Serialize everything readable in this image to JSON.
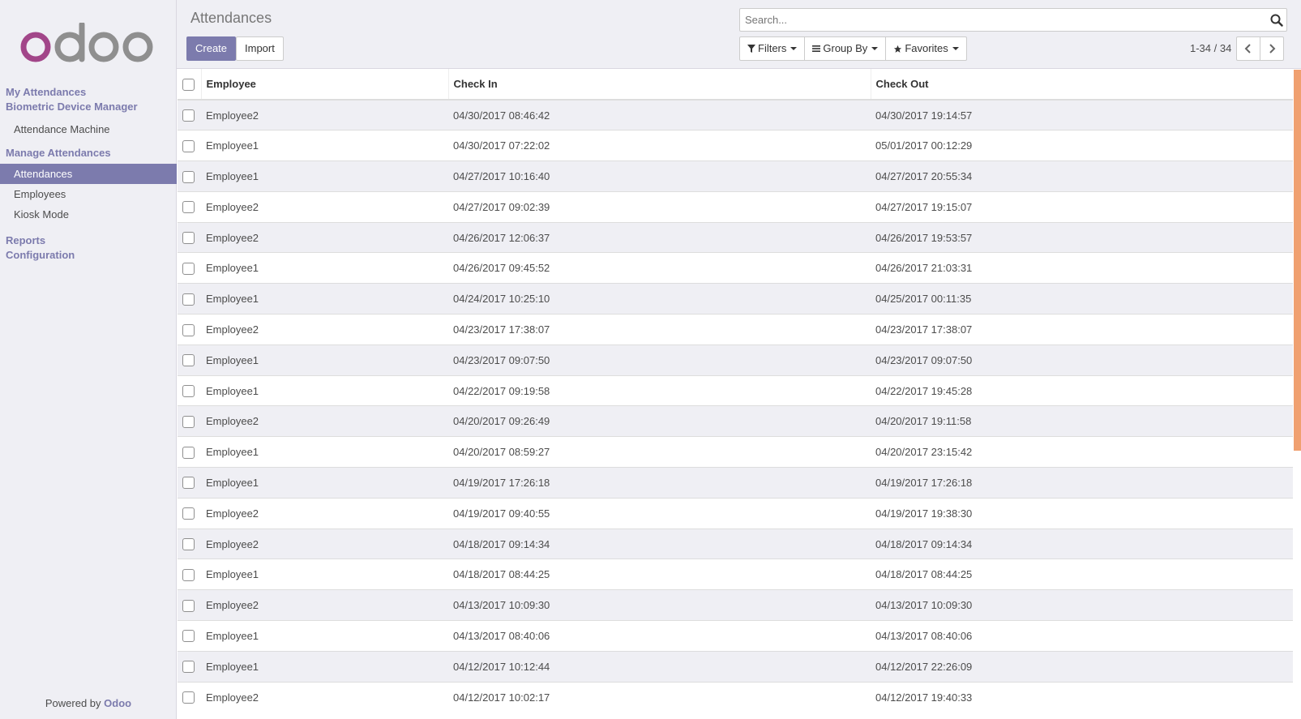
{
  "sidebar": {
    "logo_text": "odoo",
    "menu": [
      {
        "type": "section",
        "label": "My Attendances"
      },
      {
        "type": "section",
        "label": "Biometric Device Manager"
      },
      {
        "type": "item",
        "label": "Attendance Machine"
      },
      {
        "type": "section",
        "label": "Manage Attendances"
      },
      {
        "type": "item",
        "label": "Attendances",
        "active": true
      },
      {
        "type": "item",
        "label": "Employees"
      },
      {
        "type": "item",
        "label": "Kiosk Mode"
      },
      {
        "type": "section",
        "label": "Reports"
      },
      {
        "type": "section",
        "label": "Configuration"
      }
    ],
    "powered_by": "Powered by",
    "powered_brand": "Odoo"
  },
  "control_panel": {
    "title": "Attendances",
    "create_label": "Create",
    "import_label": "Import",
    "search_placeholder": "Search...",
    "filters_label": "Filters",
    "group_by_label": "Group By",
    "favorites_label": "Favorites",
    "pager_value": "1-34 / 34"
  },
  "table": {
    "columns": [
      "Employee",
      "Check In",
      "Check Out"
    ],
    "rows": [
      [
        "Employee2",
        "04/30/2017 08:46:42",
        "04/30/2017 19:14:57"
      ],
      [
        "Employee1",
        "04/30/2017 07:22:02",
        "05/01/2017 00:12:29"
      ],
      [
        "Employee1",
        "04/27/2017 10:16:40",
        "04/27/2017 20:55:34"
      ],
      [
        "Employee2",
        "04/27/2017 09:02:39",
        "04/27/2017 19:15:07"
      ],
      [
        "Employee2",
        "04/26/2017 12:06:37",
        "04/26/2017 19:53:57"
      ],
      [
        "Employee1",
        "04/26/2017 09:45:52",
        "04/26/2017 21:03:31"
      ],
      [
        "Employee1",
        "04/24/2017 10:25:10",
        "04/25/2017 00:11:35"
      ],
      [
        "Employee2",
        "04/23/2017 17:38:07",
        "04/23/2017 17:38:07"
      ],
      [
        "Employee1",
        "04/23/2017 09:07:50",
        "04/23/2017 09:07:50"
      ],
      [
        "Employee1",
        "04/22/2017 09:19:58",
        "04/22/2017 19:45:28"
      ],
      [
        "Employee2",
        "04/20/2017 09:26:49",
        "04/20/2017 19:11:58"
      ],
      [
        "Employee1",
        "04/20/2017 08:59:27",
        "04/20/2017 23:15:42"
      ],
      [
        "Employee1",
        "04/19/2017 17:26:18",
        "04/19/2017 17:26:18"
      ],
      [
        "Employee2",
        "04/19/2017 09:40:55",
        "04/19/2017 19:38:30"
      ],
      [
        "Employee2",
        "04/18/2017 09:14:34",
        "04/18/2017 09:14:34"
      ],
      [
        "Employee1",
        "04/18/2017 08:44:25",
        "04/18/2017 08:44:25"
      ],
      [
        "Employee2",
        "04/13/2017 10:09:30",
        "04/13/2017 10:09:30"
      ],
      [
        "Employee1",
        "04/13/2017 08:40:06",
        "04/13/2017 08:40:06"
      ],
      [
        "Employee1",
        "04/12/2017 10:12:44",
        "04/12/2017 22:26:09"
      ],
      [
        "Employee2",
        "04/12/2017 10:02:17",
        "04/12/2017 19:40:33"
      ]
    ]
  },
  "colors": {
    "brand_purple": "#7c7bad",
    "logo_magenta": "#a24689",
    "logo_grey": "#8f8f8f",
    "scrollbar": "#f0a070"
  },
  "icons": {
    "search": "search-icon",
    "filter": "filter-icon",
    "group_by": "list-icon",
    "favorites": "star-icon",
    "pager_prev": "chevron-left-icon",
    "pager_next": "chevron-right-icon"
  }
}
